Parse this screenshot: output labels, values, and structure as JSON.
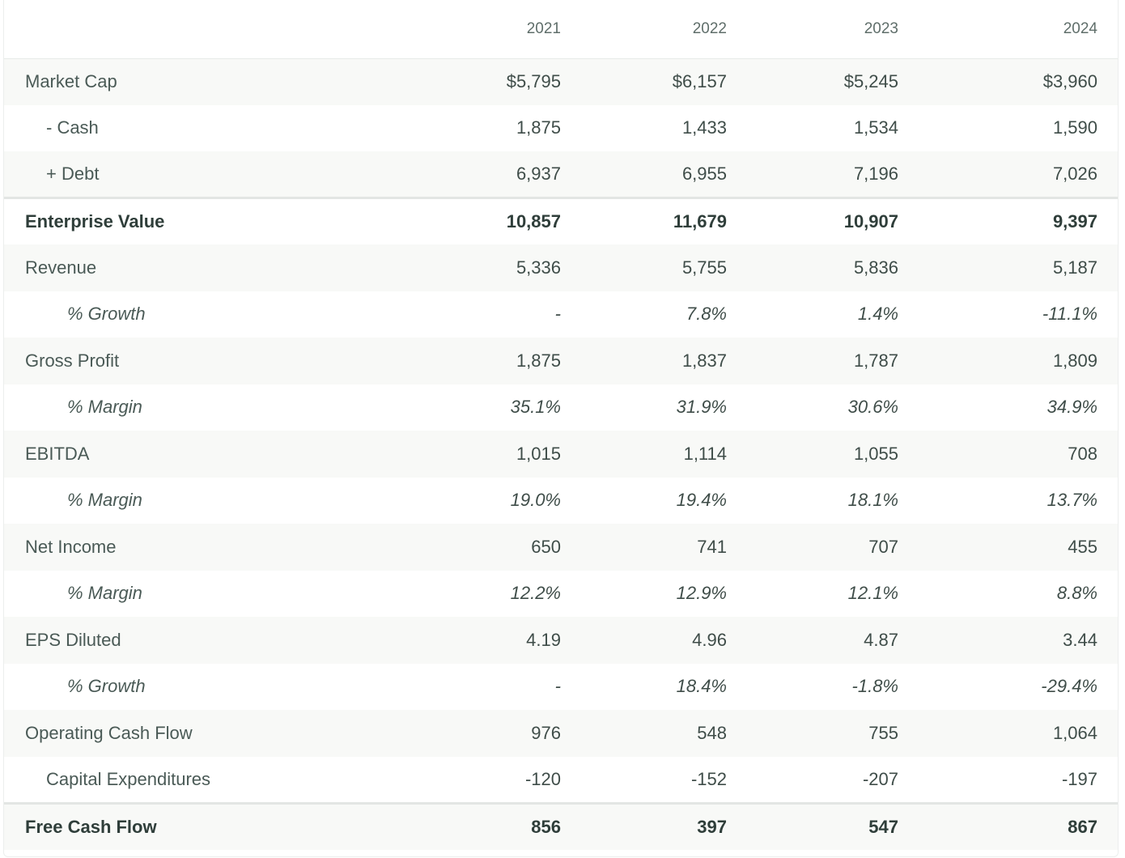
{
  "table": {
    "columns": [
      "",
      "2021",
      "2022",
      "2023",
      "2024"
    ],
    "rows": [
      {
        "label": "Market Cap",
        "values": [
          "$5,795",
          "$6,157",
          "$5,245",
          "$3,960"
        ]
      },
      {
        "label": "- Cash",
        "values": [
          "1,875",
          "1,433",
          "1,534",
          "1,590"
        ]
      },
      {
        "label": "+ Debt",
        "values": [
          "6,937",
          "6,955",
          "7,196",
          "7,026"
        ]
      },
      {
        "label": "Enterprise Value",
        "values": [
          "10,857",
          "11,679",
          "10,907",
          "9,397"
        ]
      },
      {
        "label": "Revenue",
        "values": [
          "5,336",
          "5,755",
          "5,836",
          "5,187"
        ]
      },
      {
        "label": "% Growth",
        "values": [
          "-",
          "7.8%",
          "1.4%",
          "-11.1%"
        ]
      },
      {
        "label": "Gross Profit",
        "values": [
          "1,875",
          "1,837",
          "1,787",
          "1,809"
        ]
      },
      {
        "label": "% Margin",
        "values": [
          "35.1%",
          "31.9%",
          "30.6%",
          "34.9%"
        ]
      },
      {
        "label": "EBITDA",
        "values": [
          "1,015",
          "1,114",
          "1,055",
          "708"
        ]
      },
      {
        "label": "% Margin",
        "values": [
          "19.0%",
          "19.4%",
          "18.1%",
          "13.7%"
        ]
      },
      {
        "label": "Net Income",
        "values": [
          "650",
          "741",
          "707",
          "455"
        ]
      },
      {
        "label": "% Margin",
        "values": [
          "12.2%",
          "12.9%",
          "12.1%",
          "8.8%"
        ]
      },
      {
        "label": "EPS Diluted",
        "values": [
          "4.19",
          "4.96",
          "4.87",
          "3.44"
        ]
      },
      {
        "label": "% Growth",
        "values": [
          "-",
          "18.4%",
          "-1.8%",
          "-29.4%"
        ]
      },
      {
        "label": "Operating Cash Flow",
        "values": [
          "976",
          "548",
          "755",
          "1,064"
        ]
      },
      {
        "label": "Capital Expenditures",
        "values": [
          "-120",
          "-152",
          "-207",
          "-197"
        ]
      },
      {
        "label": "Free Cash Flow",
        "values": [
          "856",
          "397",
          "547",
          "867"
        ]
      }
    ]
  }
}
